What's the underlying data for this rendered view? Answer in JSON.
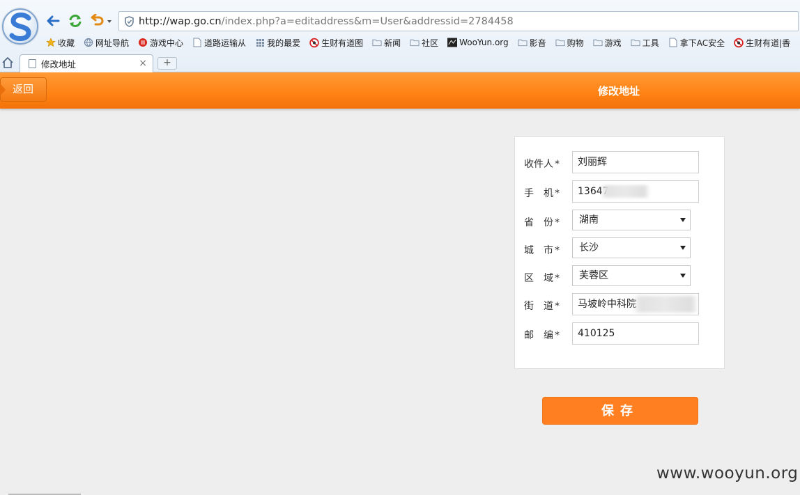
{
  "browser": {
    "url_host": "http://wap.go.cn",
    "url_path": "/index.php?a=editaddress&m=User&addressid=2784458",
    "bookmarks": [
      {
        "label": "收藏",
        "icon": "star-icon"
      },
      {
        "label": "网址导航",
        "icon": "globe-icon"
      },
      {
        "label": "游戏中心",
        "icon": "game-center-icon"
      },
      {
        "label": "道路运输从",
        "icon": "page-icon"
      },
      {
        "label": "我的最爱",
        "icon": "grid-icon"
      },
      {
        "label": "生财有道图",
        "icon": "no-icon"
      },
      {
        "label": "新闻",
        "icon": "folder-icon"
      },
      {
        "label": "社区",
        "icon": "folder-icon"
      },
      {
        "label": "WooYun.org",
        "icon": "wooyun-icon"
      },
      {
        "label": "影音",
        "icon": "folder-icon"
      },
      {
        "label": "购物",
        "icon": "folder-icon"
      },
      {
        "label": "游戏",
        "icon": "folder-icon"
      },
      {
        "label": "工具",
        "icon": "folder-icon"
      },
      {
        "label": "拿下AC安全",
        "icon": "page-icon"
      },
      {
        "label": "生财有道|香",
        "icon": "no-icon"
      }
    ],
    "tab_title": "修改地址",
    "tab_close": "×",
    "new_tab": "+"
  },
  "header": {
    "back_label": "返回",
    "title": "修改地址"
  },
  "form": {
    "receiver": {
      "label": "收件人",
      "star": "*",
      "value": "刘丽辉"
    },
    "phone": {
      "label": "手　机",
      "star": "*",
      "value": "13647"
    },
    "province": {
      "label": "省　份",
      "star": "*",
      "value": "湖南"
    },
    "city": {
      "label": "城　市",
      "star": "*",
      "value": "长沙"
    },
    "district": {
      "label": "区　域",
      "star": "*",
      "value": "芙蓉区"
    },
    "street": {
      "label": "街　道",
      "star": "*",
      "value": "马坡岭中科院"
    },
    "zipcode": {
      "label": "邮　编",
      "star": "*",
      "value": "410125"
    }
  },
  "save_label": "保存",
  "watermark": "www.wooyun.org",
  "colors": {
    "accent": "#ff8214",
    "button": "#ff7f21"
  }
}
